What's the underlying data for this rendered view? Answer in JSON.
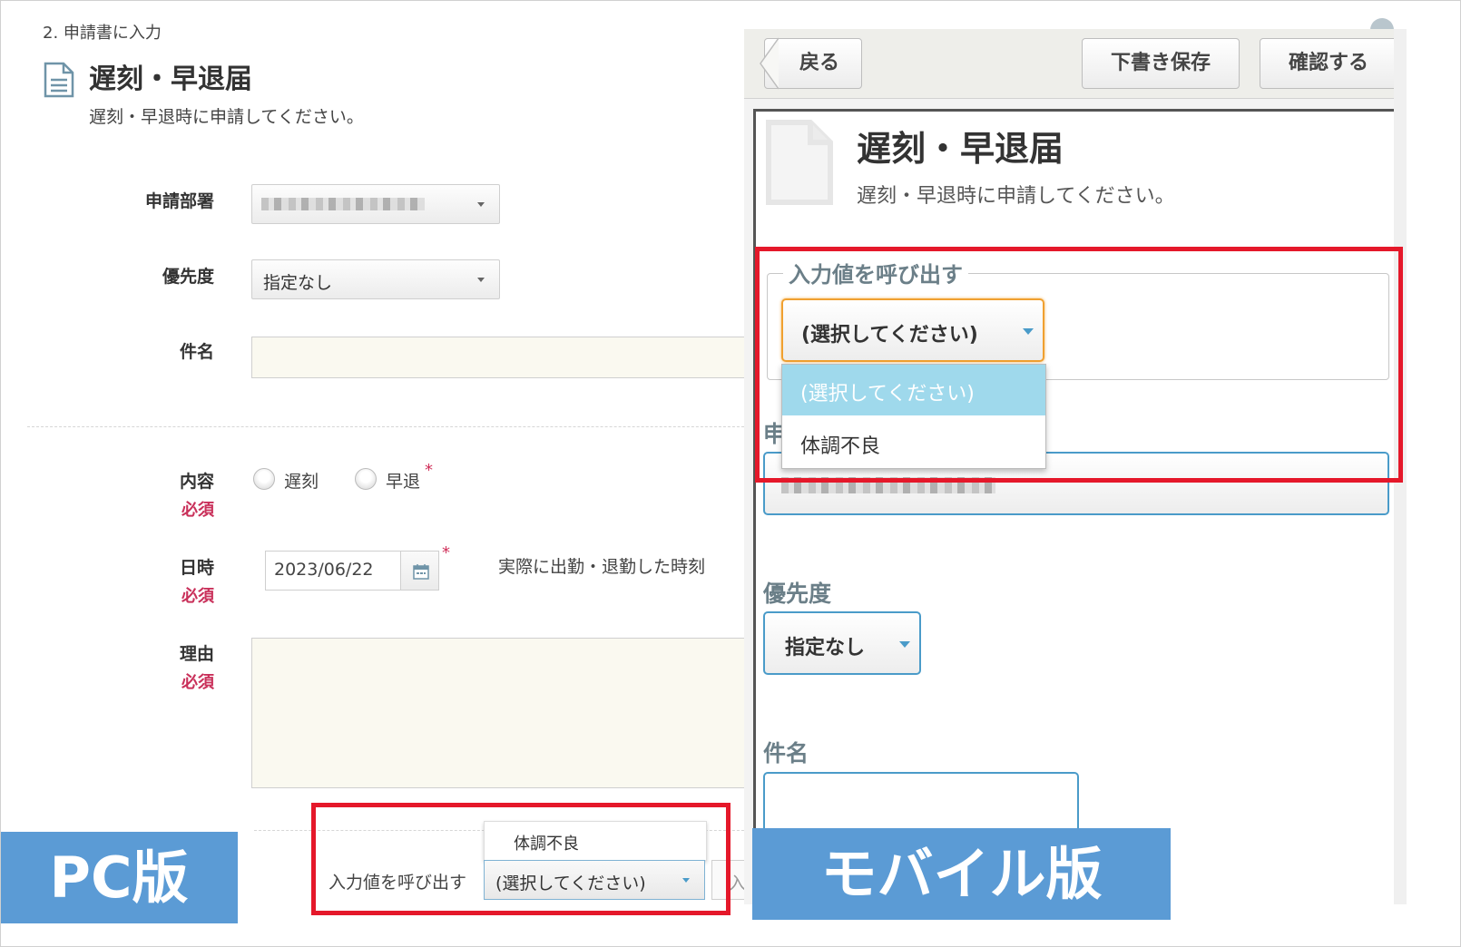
{
  "pc": {
    "step": "2. 申請書に入力",
    "form_title": "遅刻・早退届",
    "form_desc": "遅刻・早退時に申請してください。",
    "dept_label": "申請部署",
    "priority_label": "優先度",
    "priority_value": "指定なし",
    "subject_label": "件名",
    "content_label": "内容",
    "required": "必須",
    "radio_late": "遅刻",
    "radio_early": "早退",
    "required_mark": "*",
    "datetime_label": "日時",
    "date_value": "2023/06/22",
    "datetime_note": "実際に出勤・退勤した時刻",
    "reason_label": "理由",
    "recall_label": "入力値を呼び出す",
    "recall_value": "(選択してください)",
    "dropdown_item": "体調不良",
    "next_field_partial": "入",
    "tag": "PC版"
  },
  "mobile": {
    "back": "戻る",
    "save_draft": "下書き保存",
    "confirm": "確認する",
    "form_title": "遅刻・早退届",
    "form_desc": "遅刻・早退時に申請してください。",
    "recall_legend": "入力値を呼び出す",
    "recall_value": "(選択してください)",
    "options": [
      "(選択してください)",
      "体調不良"
    ],
    "dept_label_partial": "申",
    "priority_label": "優先度",
    "priority_value": "指定なし",
    "subject_label": "件名",
    "tag": "モバイル版"
  },
  "colors": {
    "highlight_red": "#e5182a",
    "tag_blue": "#5b9bd5",
    "required_pink": "#c9305a",
    "mobile_label": "#6b7f88",
    "focus_orange": "#f0a030",
    "mobile_select_border": "#4a9bc9",
    "option_selected": "#9fd9ec"
  }
}
